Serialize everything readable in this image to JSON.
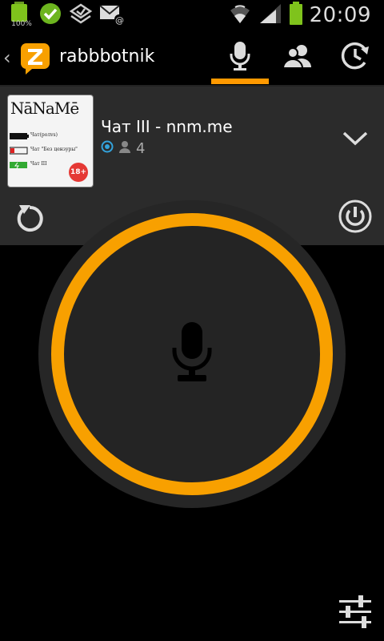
{
  "status_bar": {
    "battery_small_label": "100%",
    "time": "20:09",
    "icons": [
      "battery-icon",
      "check-circle-icon",
      "stack-icon",
      "mail-icon",
      "wifi-icon",
      "signal-icon",
      "battery-icon"
    ]
  },
  "action_bar": {
    "title": "rabbbotnik",
    "tabs": [
      {
        "icon": "microphone-icon",
        "selected": true
      },
      {
        "icon": "contacts-icon",
        "selected": false
      },
      {
        "icon": "recents-icon",
        "selected": false
      }
    ]
  },
  "channel": {
    "thumbnail": {
      "title": "NāNaMē",
      "lines": [
        "Чат(рoлvs)",
        "Чат \"Без цензуры\"",
        "Чат III"
      ],
      "badge": "18+"
    },
    "name": "Чат III - nnm.me",
    "users_count": "4"
  },
  "colors": {
    "accent": "#f8a000",
    "tab_indicator": "#ff9900",
    "panel_bg": "#2b2b2b",
    "status_green": "#7fc31c",
    "badge_red": "#e53935",
    "online_blue": "#33a3dc"
  }
}
